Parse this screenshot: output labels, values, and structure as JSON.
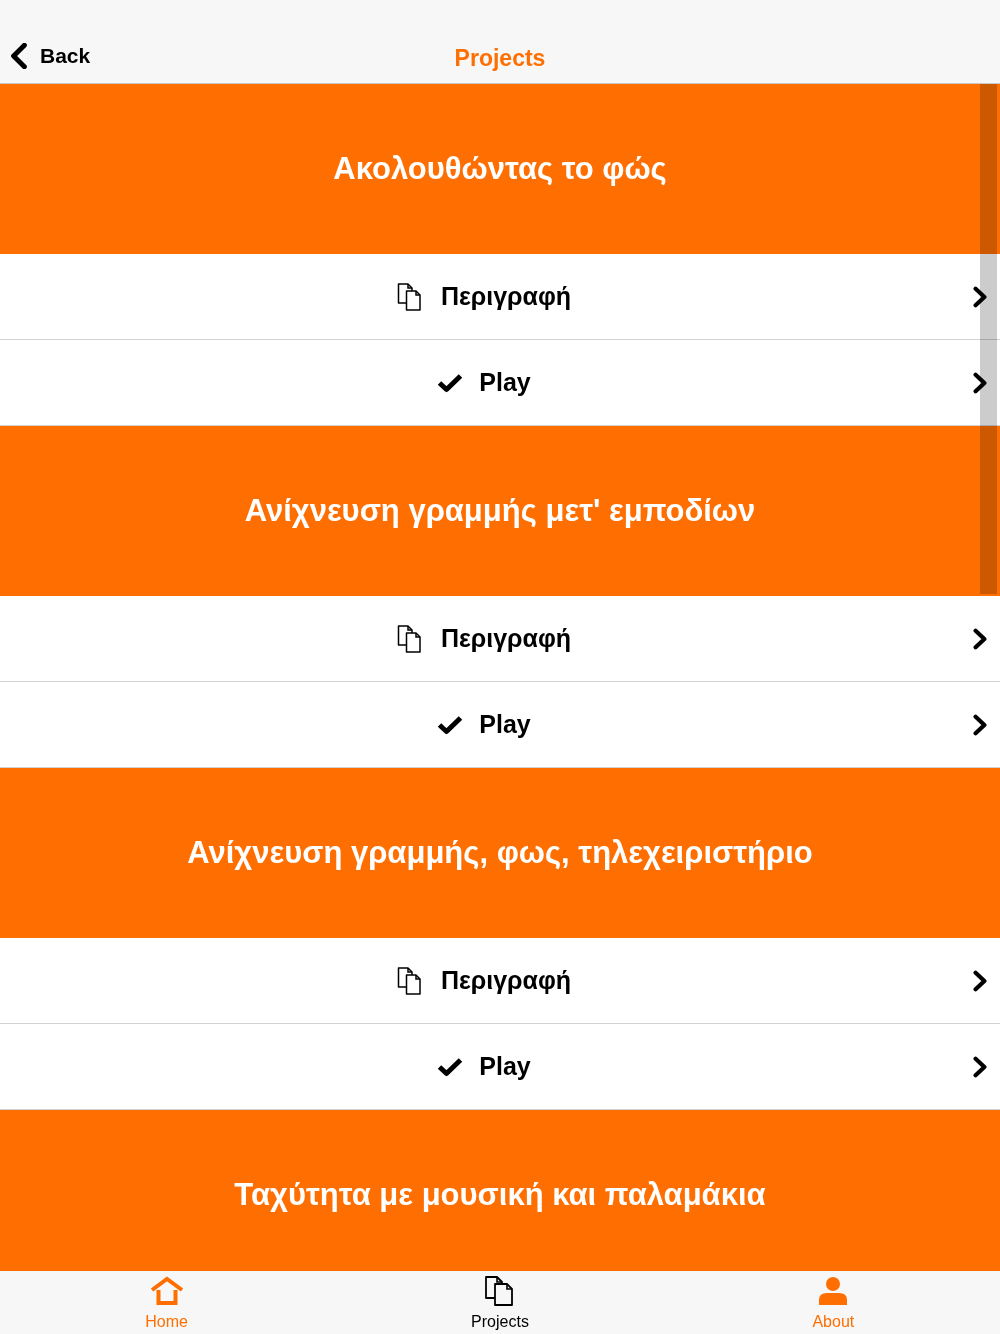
{
  "nav_bar": {
    "back_label": "Back",
    "title": "Projects"
  },
  "projects": [
    {
      "title": "Ακολουθώντας το φώς",
      "items": [
        {
          "kind": "description",
          "label": "Περιγραφή"
        },
        {
          "kind": "play",
          "label": "Play"
        }
      ]
    },
    {
      "title": "Ανίχνευση γραμμής μετ' εμποδίων",
      "items": [
        {
          "kind": "description",
          "label": "Περιγραφή"
        },
        {
          "kind": "play",
          "label": "Play"
        }
      ]
    },
    {
      "title": "Ανίχνευση γραμμής, φως, τηλεχειριστήριο",
      "items": [
        {
          "kind": "description",
          "label": "Περιγραφή"
        },
        {
          "kind": "play",
          "label": "Play"
        }
      ]
    },
    {
      "title": "Ταχύτητα με μουσική και παλαμάκια"
    }
  ],
  "tab_bar": [
    {
      "kind": "home",
      "label": "Home",
      "selected": false
    },
    {
      "kind": "projects",
      "label": "Projects",
      "selected": true
    },
    {
      "kind": "about",
      "label": "About",
      "selected": false
    }
  ]
}
